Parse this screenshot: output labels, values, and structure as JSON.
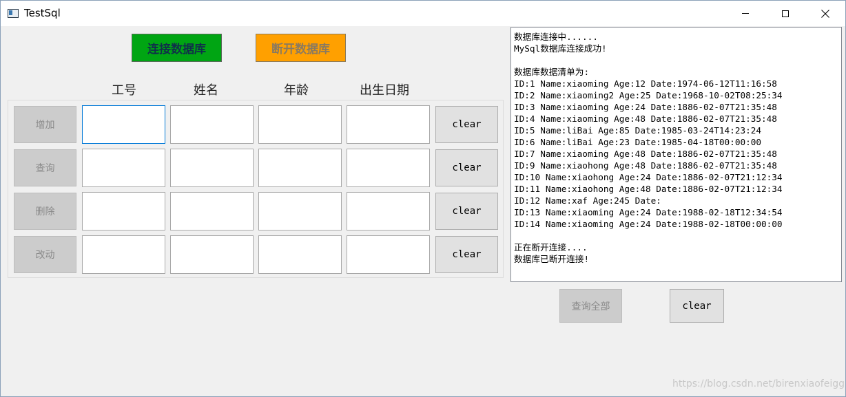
{
  "window": {
    "title": "TestSql"
  },
  "toolbar": {
    "connect_label": "连接数据库",
    "disconnect_label": "断开数据库"
  },
  "columns": [
    "工号",
    "姓名",
    "年龄",
    "出生日期"
  ],
  "rows": [
    {
      "action": "增加",
      "clear": "clear"
    },
    {
      "action": "查询",
      "clear": "clear"
    },
    {
      "action": "删除",
      "clear": "clear"
    },
    {
      "action": "改动",
      "clear": "clear"
    }
  ],
  "log": {
    "lines": [
      "数据库连接中......",
      "MySql数据库连接成功!",
      "",
      "数据库数据清单为:",
      "ID:1 Name:xiaoming Age:12 Date:1974-06-12T11:16:58",
      "ID:2 Name:xiaoming2 Age:25 Date:1968-10-02T08:25:34",
      "ID:3 Name:xiaoming Age:24 Date:1886-02-07T21:35:48",
      "ID:4 Name:xiaoming Age:48 Date:1886-02-07T21:35:48",
      "ID:5 Name:liBai Age:85 Date:1985-03-24T14:23:24",
      "ID:6 Name:liBai Age:23 Date:1985-04-18T00:00:00",
      "ID:7 Name:xiaoming Age:48 Date:1886-02-07T21:35:48",
      "ID:9 Name:xiaohong Age:48 Date:1886-02-07T21:35:48",
      "ID:10 Name:xiaohong Age:24 Date:1886-02-07T21:12:34",
      "ID:11 Name:xiaohong Age:48 Date:1886-02-07T21:12:34",
      "ID:12 Name:xaf Age:245 Date:",
      "ID:13 Name:xiaoming Age:24 Date:1988-02-18T12:34:54",
      "ID:14 Name:xiaoming Age:24 Date:1988-02-18T00:00:00",
      "",
      "正在断开连接....",
      "数据库已断开连接!"
    ]
  },
  "bottom": {
    "query_all_label": "查询全部",
    "clear_label": "clear"
  },
  "watermark": "https://blog.csdn.net/birenxiaofeigg",
  "colors": {
    "connect_bg": "#00a513",
    "disconnect_bg": "#ffa000",
    "focus_border": "#0078d7"
  }
}
